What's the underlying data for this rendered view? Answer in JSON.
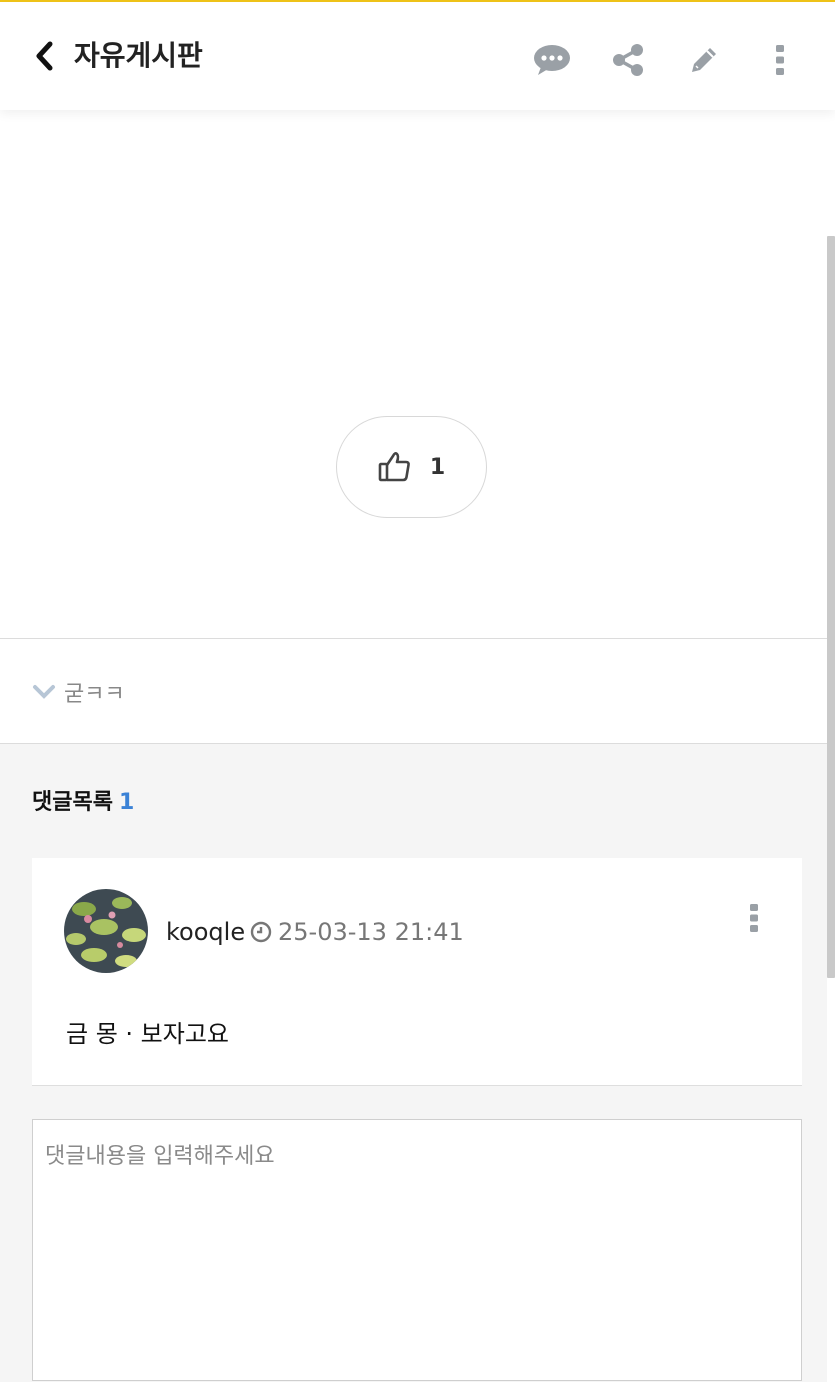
{
  "header": {
    "title": "자유게시판",
    "icons": [
      "back-chevron-icon",
      "comment-bubble-icon",
      "share-icon",
      "pencil-icon",
      "more-vertical-icon"
    ],
    "accent_color": "#f0c419",
    "icon_color": "#9aa0a6"
  },
  "like": {
    "icon": "thumbs-up-icon",
    "count": "1"
  },
  "tag": {
    "icon": "chevron-down-icon",
    "label": "굳ㅋㅋ"
  },
  "comments": {
    "title": "댓글목록",
    "count": "1",
    "count_color": "#3b82d6",
    "items": [
      {
        "author": "kooqle",
        "date": "25-03-13 21:41",
        "text": "금 몽 · 보자고요",
        "avatar": "lily-pond-avatar",
        "icons": [
          "clock-icon",
          "more-vertical-icon"
        ]
      }
    ]
  },
  "comment_input": {
    "placeholder": "댓글내용을 입력해주세요",
    "value": ""
  }
}
